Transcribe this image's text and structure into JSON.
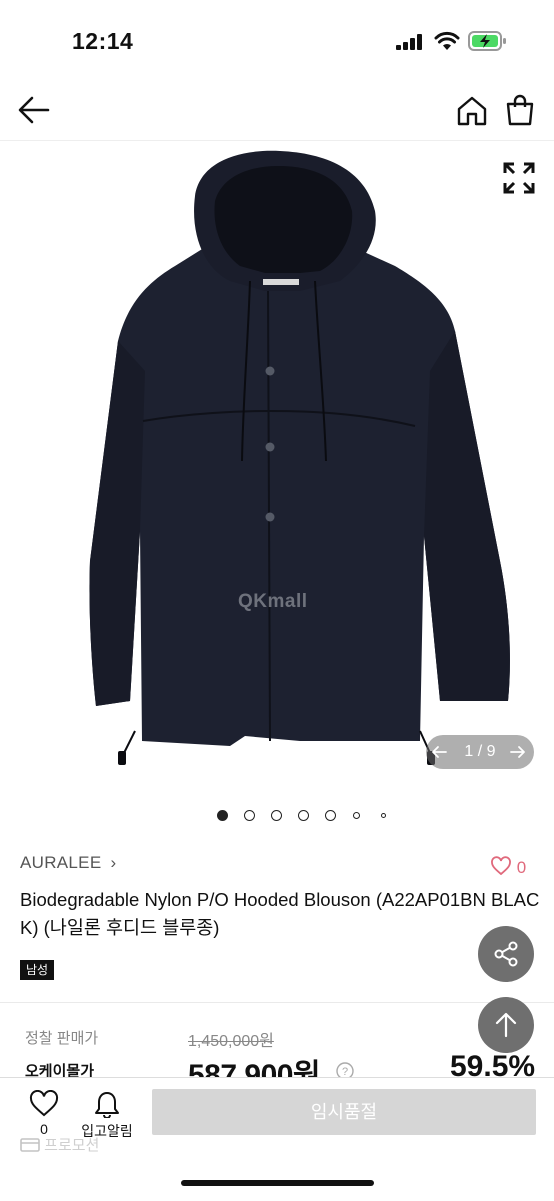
{
  "status_bar": {
    "time": "12:14"
  },
  "hero": {
    "watermark": "QKmall",
    "counter": "1 / 9"
  },
  "product": {
    "brand": "AURALEE",
    "like_count": "0",
    "title": "Biodegradable Nylon P/O Hooded Blouson (A22AP01BN BLACK) (나일론 후디드 블루종)",
    "gender_tag": "남성"
  },
  "pricing": {
    "retail_label": "정찰 판매가",
    "retail_price": "1,450,000원",
    "sale_label": "오케이몰가",
    "sale_price": "587,900원",
    "discount": "59.5%",
    "promo_label": "프로모션"
  },
  "bottom_bar": {
    "wish_count": "0",
    "restock_label": "입고알림",
    "soldout_label": "임시품절"
  },
  "colors": {
    "like_accent": "#e0697c",
    "discount_accent": "#111111"
  }
}
